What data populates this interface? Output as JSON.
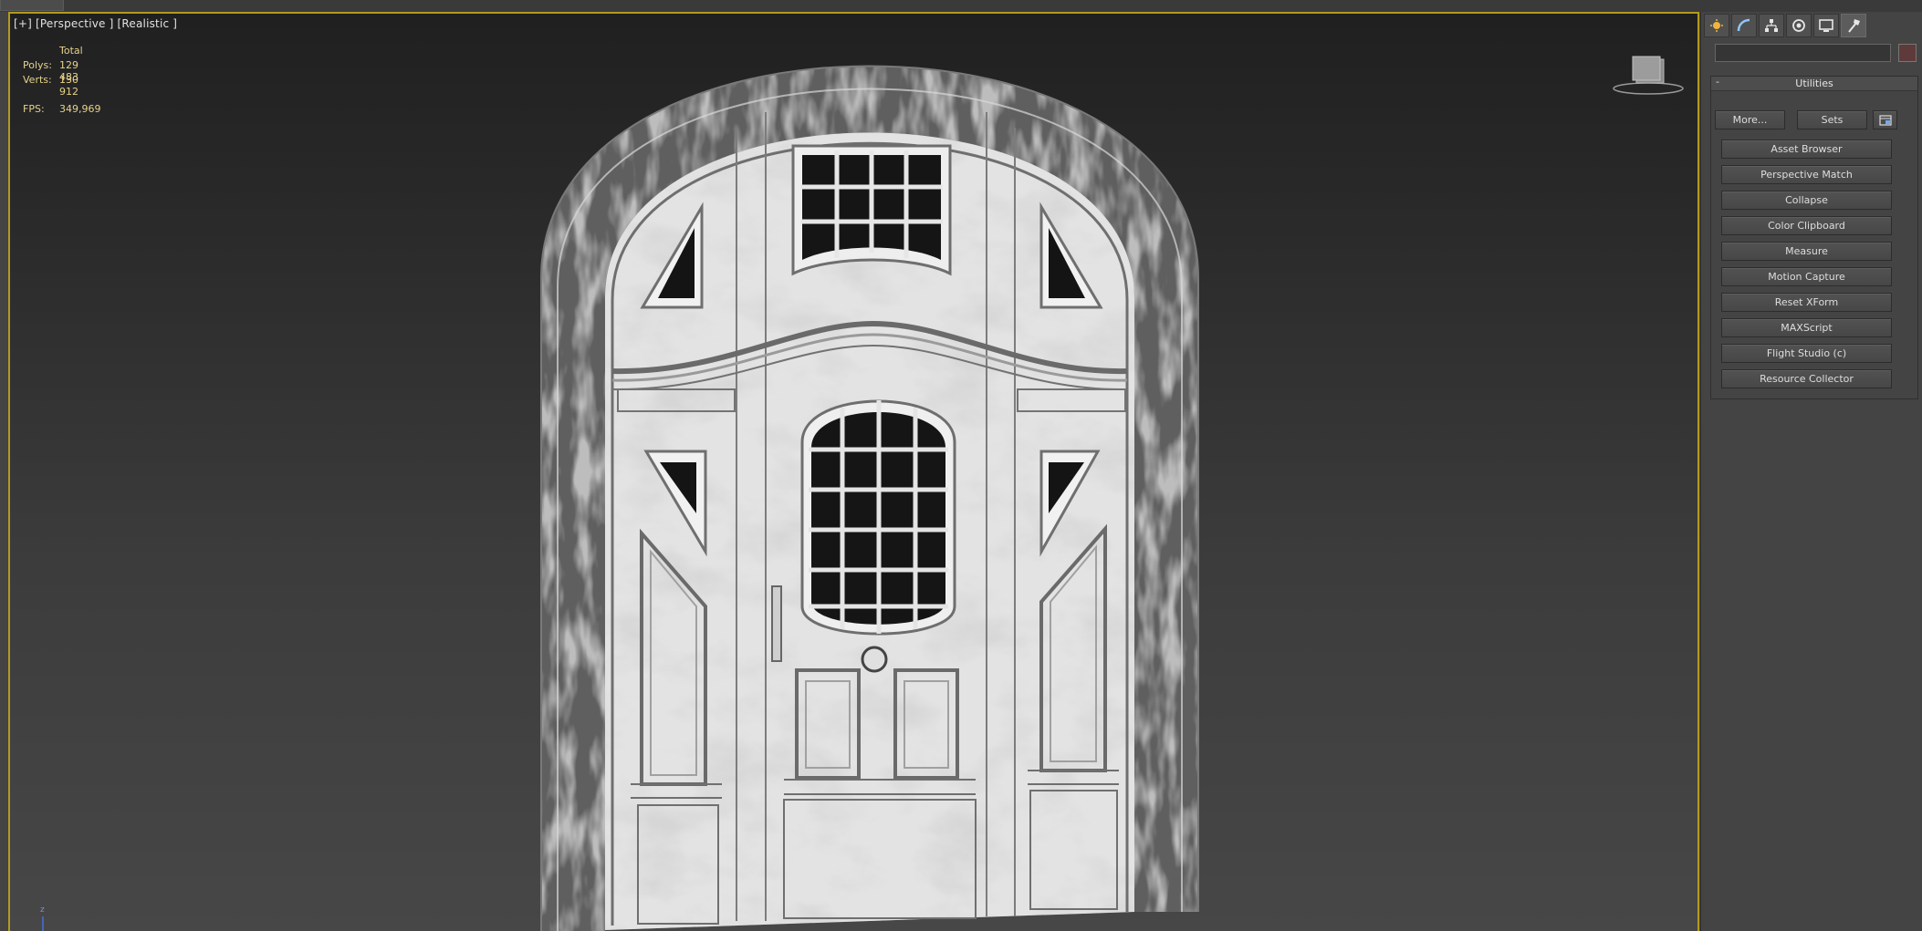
{
  "viewport": {
    "label": "[+] [Perspective ] [Realistic ]",
    "stats": {
      "header": "Total",
      "polys_label": "Polys:",
      "polys_value": "129 483",
      "verts_label": "Verts:",
      "verts_value": "130 912",
      "fps_label": "FPS:",
      "fps_value": "349,969"
    },
    "axis_label": "z"
  },
  "command_panel": {
    "tabs": [
      {
        "icon": "create-icon"
      },
      {
        "icon": "modify-icon"
      },
      {
        "icon": "hierarchy-icon"
      },
      {
        "icon": "motion-icon"
      },
      {
        "icon": "display-icon"
      },
      {
        "icon": "utilities-icon",
        "active": true
      }
    ],
    "name_field_value": "",
    "color_swatch": "#5e3a3a",
    "rollout": {
      "toggle": "-",
      "title": "Utilities",
      "more_label": "More...",
      "sets_label": "Sets",
      "utilities": [
        "Asset Browser",
        "Perspective Match",
        "Collapse",
        "Color Clipboard",
        "Measure",
        "Motion Capture",
        "Reset XForm",
        "MAXScript",
        "Flight Studio (c)",
        "Resource Collector"
      ]
    }
  },
  "colors": {
    "accent": "#b39a1e",
    "stats_text": "#e6d28a",
    "panel_bg": "#444444"
  }
}
